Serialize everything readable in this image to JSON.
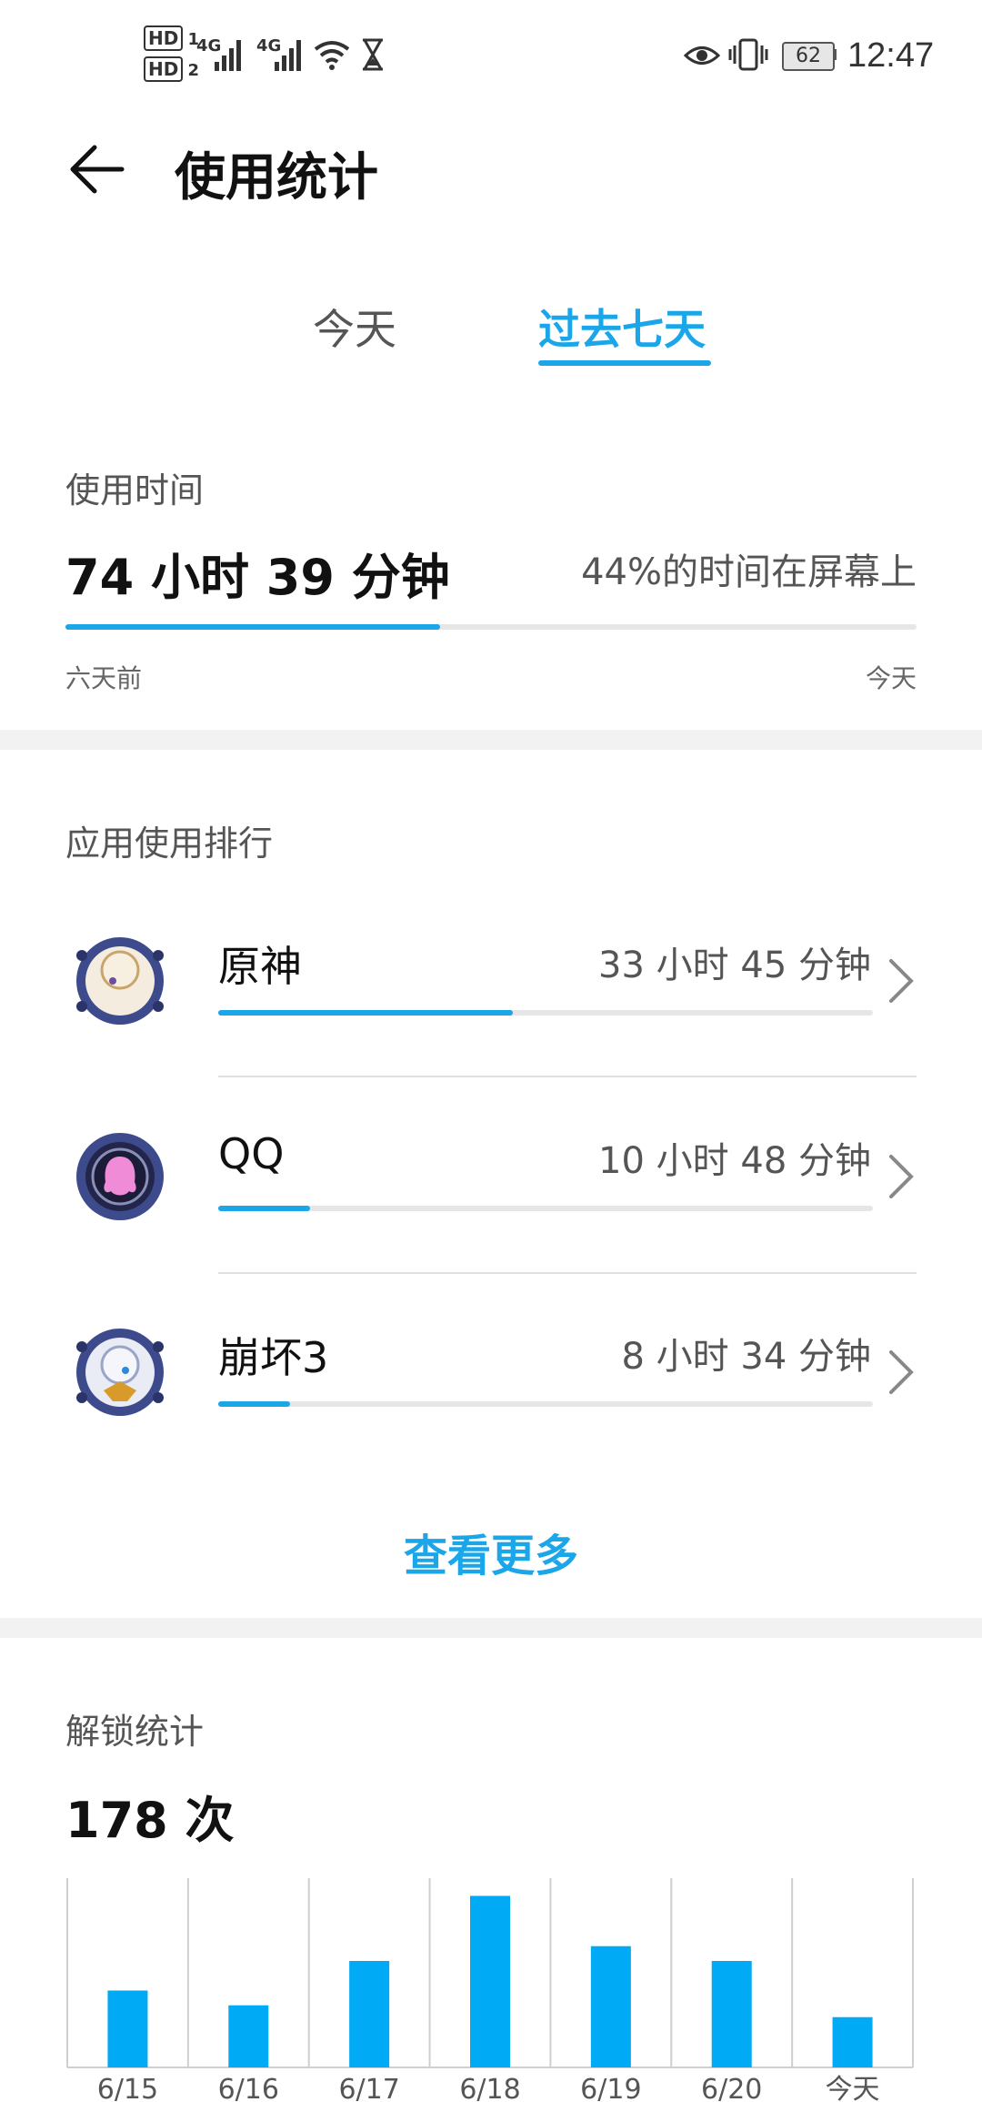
{
  "status_bar": {
    "hd1": "HD",
    "hd1_sub": "1",
    "hd2": "HD",
    "hd2_sub": "2",
    "net1": "4G",
    "net2": "4G",
    "battery": "62",
    "time": "12:47",
    "icons": [
      "signal-bars-icon",
      "signal-bars-icon",
      "wifi-icon",
      "hourglass-icon",
      "eye-icon",
      "vibrate-icon",
      "battery-icon"
    ]
  },
  "header": {
    "back_icon": "back-arrow-icon",
    "title": "使用统计"
  },
  "tabs": [
    {
      "label": "今天",
      "active": false
    },
    {
      "label": "过去七天",
      "active": true
    }
  ],
  "usage": {
    "section_label": "使用时间",
    "total": "74 小时 39 分钟",
    "screen_pct_text": "44%的时间在屏幕上",
    "progress": 0.44,
    "start_label": "六天前",
    "end_label": "今天"
  },
  "ranking": {
    "section_label": "应用使用排行",
    "apps": [
      {
        "name": "原神",
        "time": "33 小时 45 分钟",
        "progress": 0.45,
        "icon": "genshin-app-icon"
      },
      {
        "name": "QQ",
        "time": "10 小时 48 分钟",
        "progress": 0.14,
        "icon": "qq-app-icon"
      },
      {
        "name": "崩坏3",
        "time": "8 小时 34 分钟",
        "progress": 0.11,
        "icon": "honkai-app-icon"
      }
    ],
    "more": "查看更多"
  },
  "unlock": {
    "section_label": "解锁统计",
    "count": "178 次"
  },
  "chart_data": {
    "type": "bar",
    "categories": [
      "6/15",
      "6/16",
      "6/17",
      "6/18",
      "6/19",
      "6/20",
      "今天"
    ],
    "values": [
      26,
      21,
      36,
      58,
      41,
      36,
      17
    ],
    "title": "",
    "xlabel": "",
    "ylabel": "",
    "ylim": [
      0,
      64
    ],
    "grid": "vertical",
    "color": "#00aaf5"
  },
  "colors": {
    "accent": "#1aa6e8",
    "bar": "#00aaf5"
  }
}
